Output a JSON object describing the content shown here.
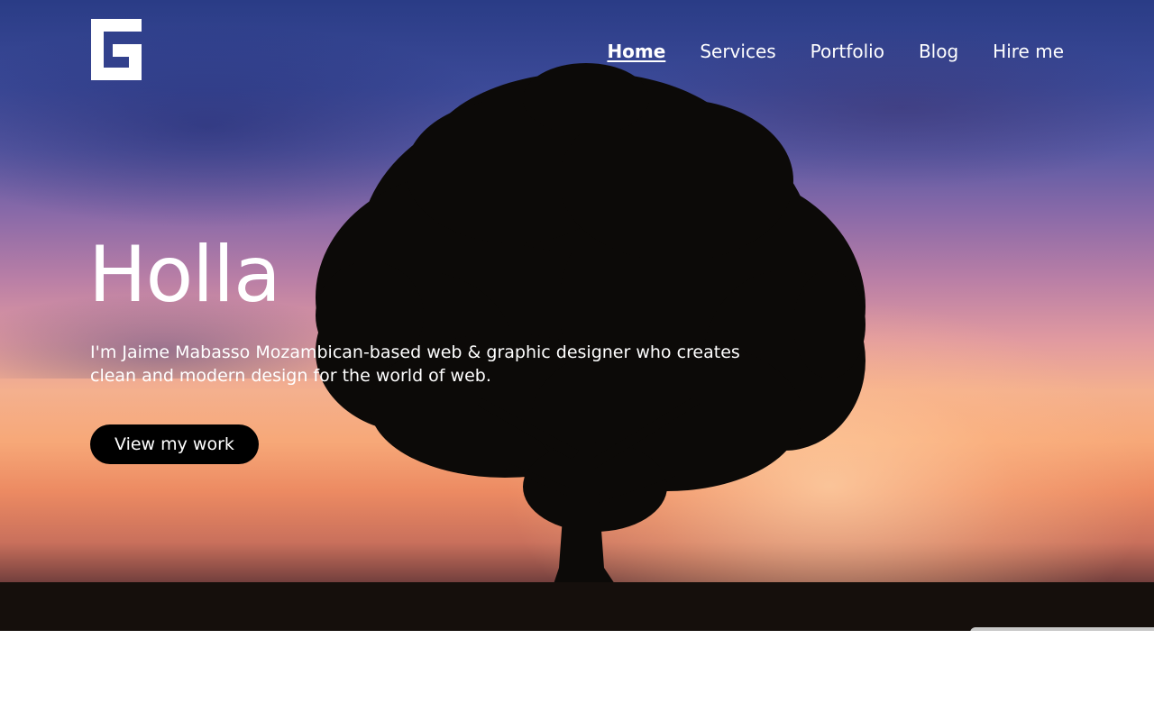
{
  "logo": {
    "icon": "g-logo-icon",
    "color": "#ffffff"
  },
  "nav": {
    "items": [
      {
        "label": "Home",
        "active": true
      },
      {
        "label": "Services",
        "active": false
      },
      {
        "label": "Portfolio",
        "active": false
      },
      {
        "label": "Blog",
        "active": false
      },
      {
        "label": "Hire me",
        "active": false
      }
    ]
  },
  "hero": {
    "title": "Holla",
    "description": "I'm Jaime Mabasso Mozambican-based web & graphic designer who creates clean and modern design for the world of web.",
    "cta_label": "View my work",
    "background": "sunset-tree-photo",
    "cta_color": "#000000",
    "text_color": "#ffffff"
  }
}
